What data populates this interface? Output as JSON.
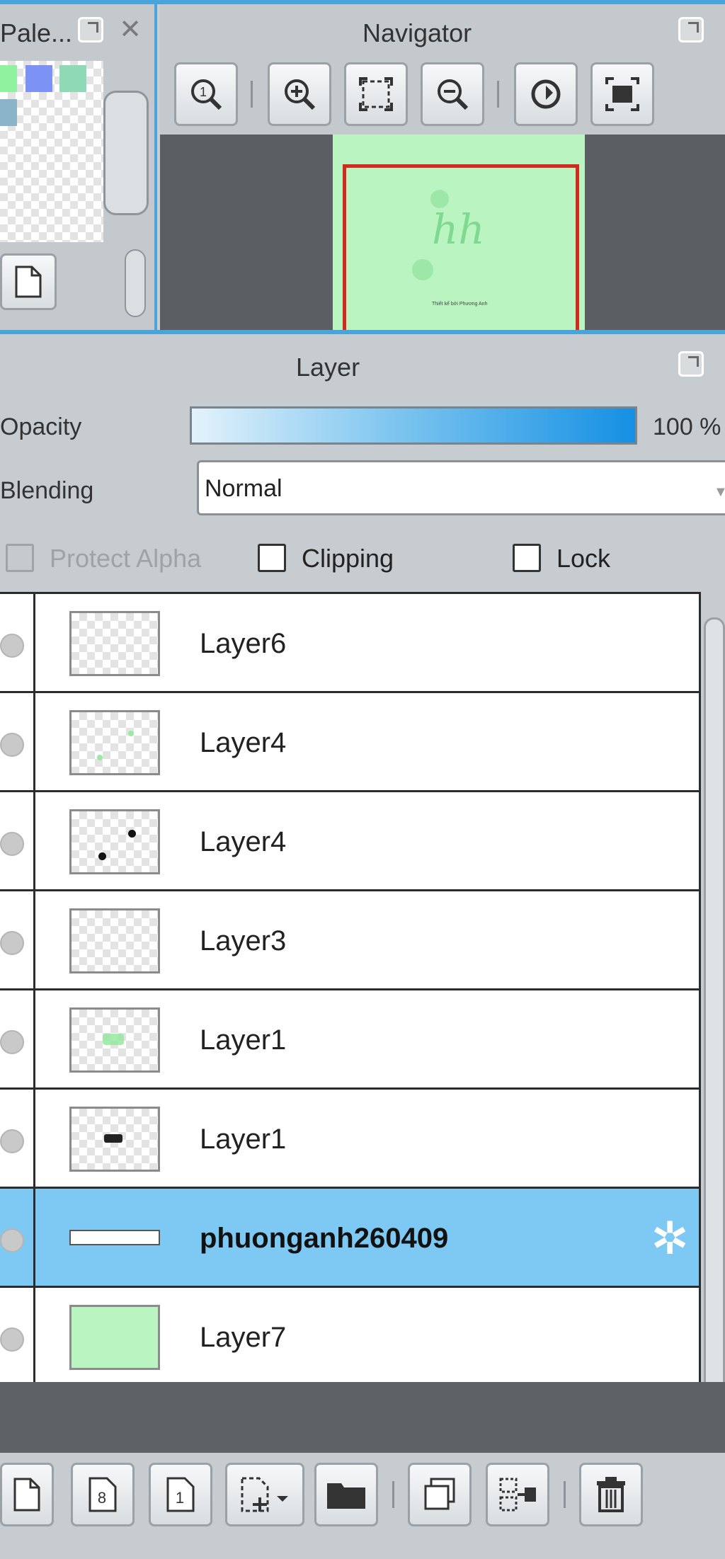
{
  "palette": {
    "title": "Pale...",
    "float_icon": "float-window-icon",
    "close_icon": "close-icon",
    "close_glyph": "✕"
  },
  "navigator": {
    "title": "Navigator",
    "canvas_text": "hh",
    "canvas_small_text": "Thiết kế bởi Phương Anh"
  },
  "layer_panel": {
    "title": "Layer",
    "opacity_label": "Opacity",
    "opacity_value": "100 %",
    "opacity_level": 1.0,
    "blending_label": "Blending",
    "blending_value": "Normal",
    "protect_alpha_label": "Protect Alpha",
    "clipping_label": "Clipping",
    "lock_label": "Lock",
    "layers": [
      {
        "name": "Layer6",
        "selected": false
      },
      {
        "name": "Layer4",
        "selected": false
      },
      {
        "name": "Layer4",
        "selected": false
      },
      {
        "name": "Layer3",
        "selected": false
      },
      {
        "name": "Layer1",
        "selected": false
      },
      {
        "name": "Layer1",
        "selected": false
      },
      {
        "name": "phuonganh260409",
        "selected": true
      },
      {
        "name": "Layer7",
        "selected": false
      }
    ],
    "gear_glyph": "✲"
  },
  "bottom_toolbar": {
    "btn_8_label": "8",
    "btn_1_label": "1"
  },
  "colors": {
    "accent": "#4ba4d9",
    "selected_row": "#7ec9f4",
    "canvas_green": "#b9f4c1",
    "nav_frame": "#d22a1e"
  }
}
